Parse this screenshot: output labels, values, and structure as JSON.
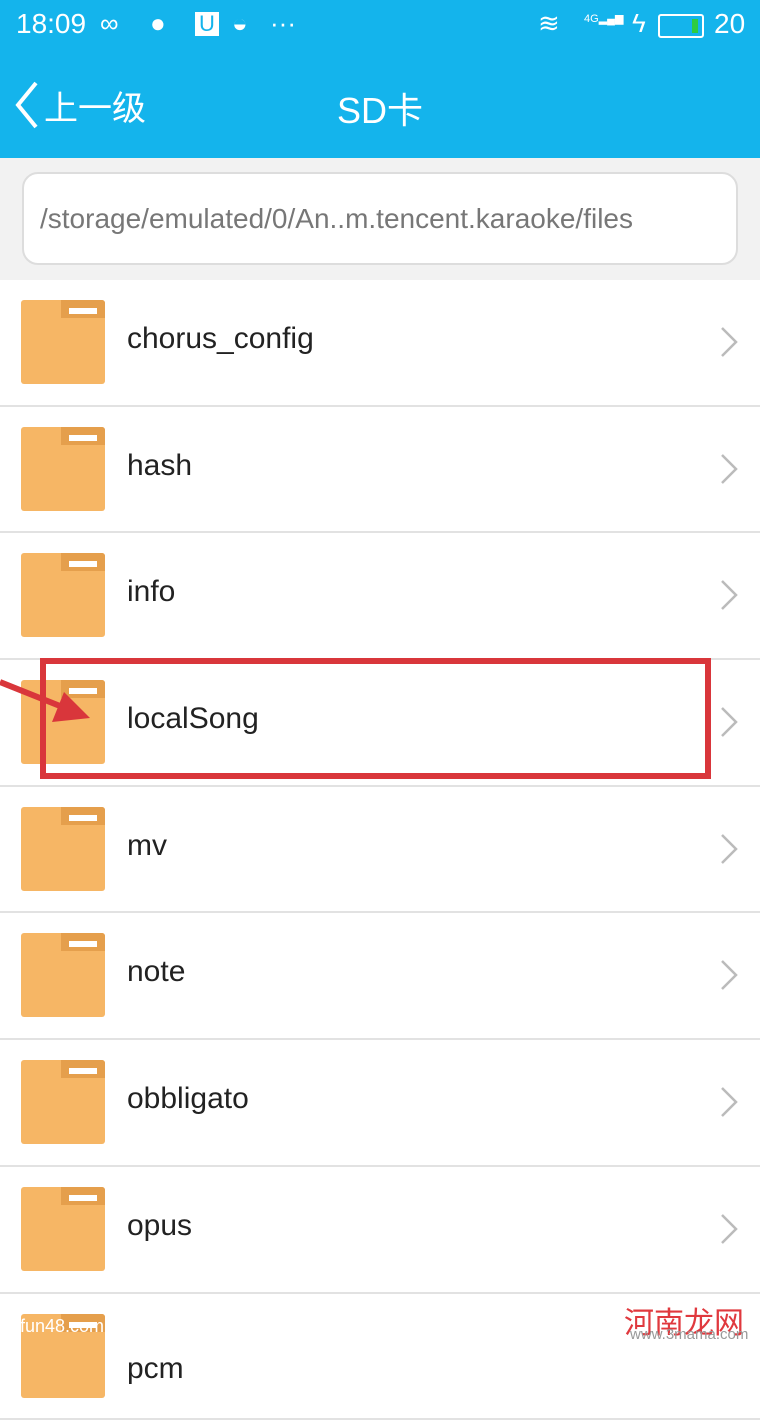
{
  "status": {
    "time": "18:09",
    "battery": "20",
    "network": "4G"
  },
  "nav": {
    "back_label": "上一级",
    "title": "SD卡"
  },
  "path": "/storage/emulated/0/An..m.tencent.karaoke/files",
  "folders": [
    "chorus_config",
    "hash",
    "info",
    "localSong",
    "mv",
    "note",
    "obbligato",
    "opus",
    "pcm"
  ],
  "highlighted": "localSong",
  "colors": {
    "header": "#14b4ec",
    "folder": "#f6b665",
    "highlight": "#d9363b"
  },
  "watermarks": {
    "left": "fun48.com",
    "right": "河南龙网",
    "right_url": "www.3mama.com"
  }
}
